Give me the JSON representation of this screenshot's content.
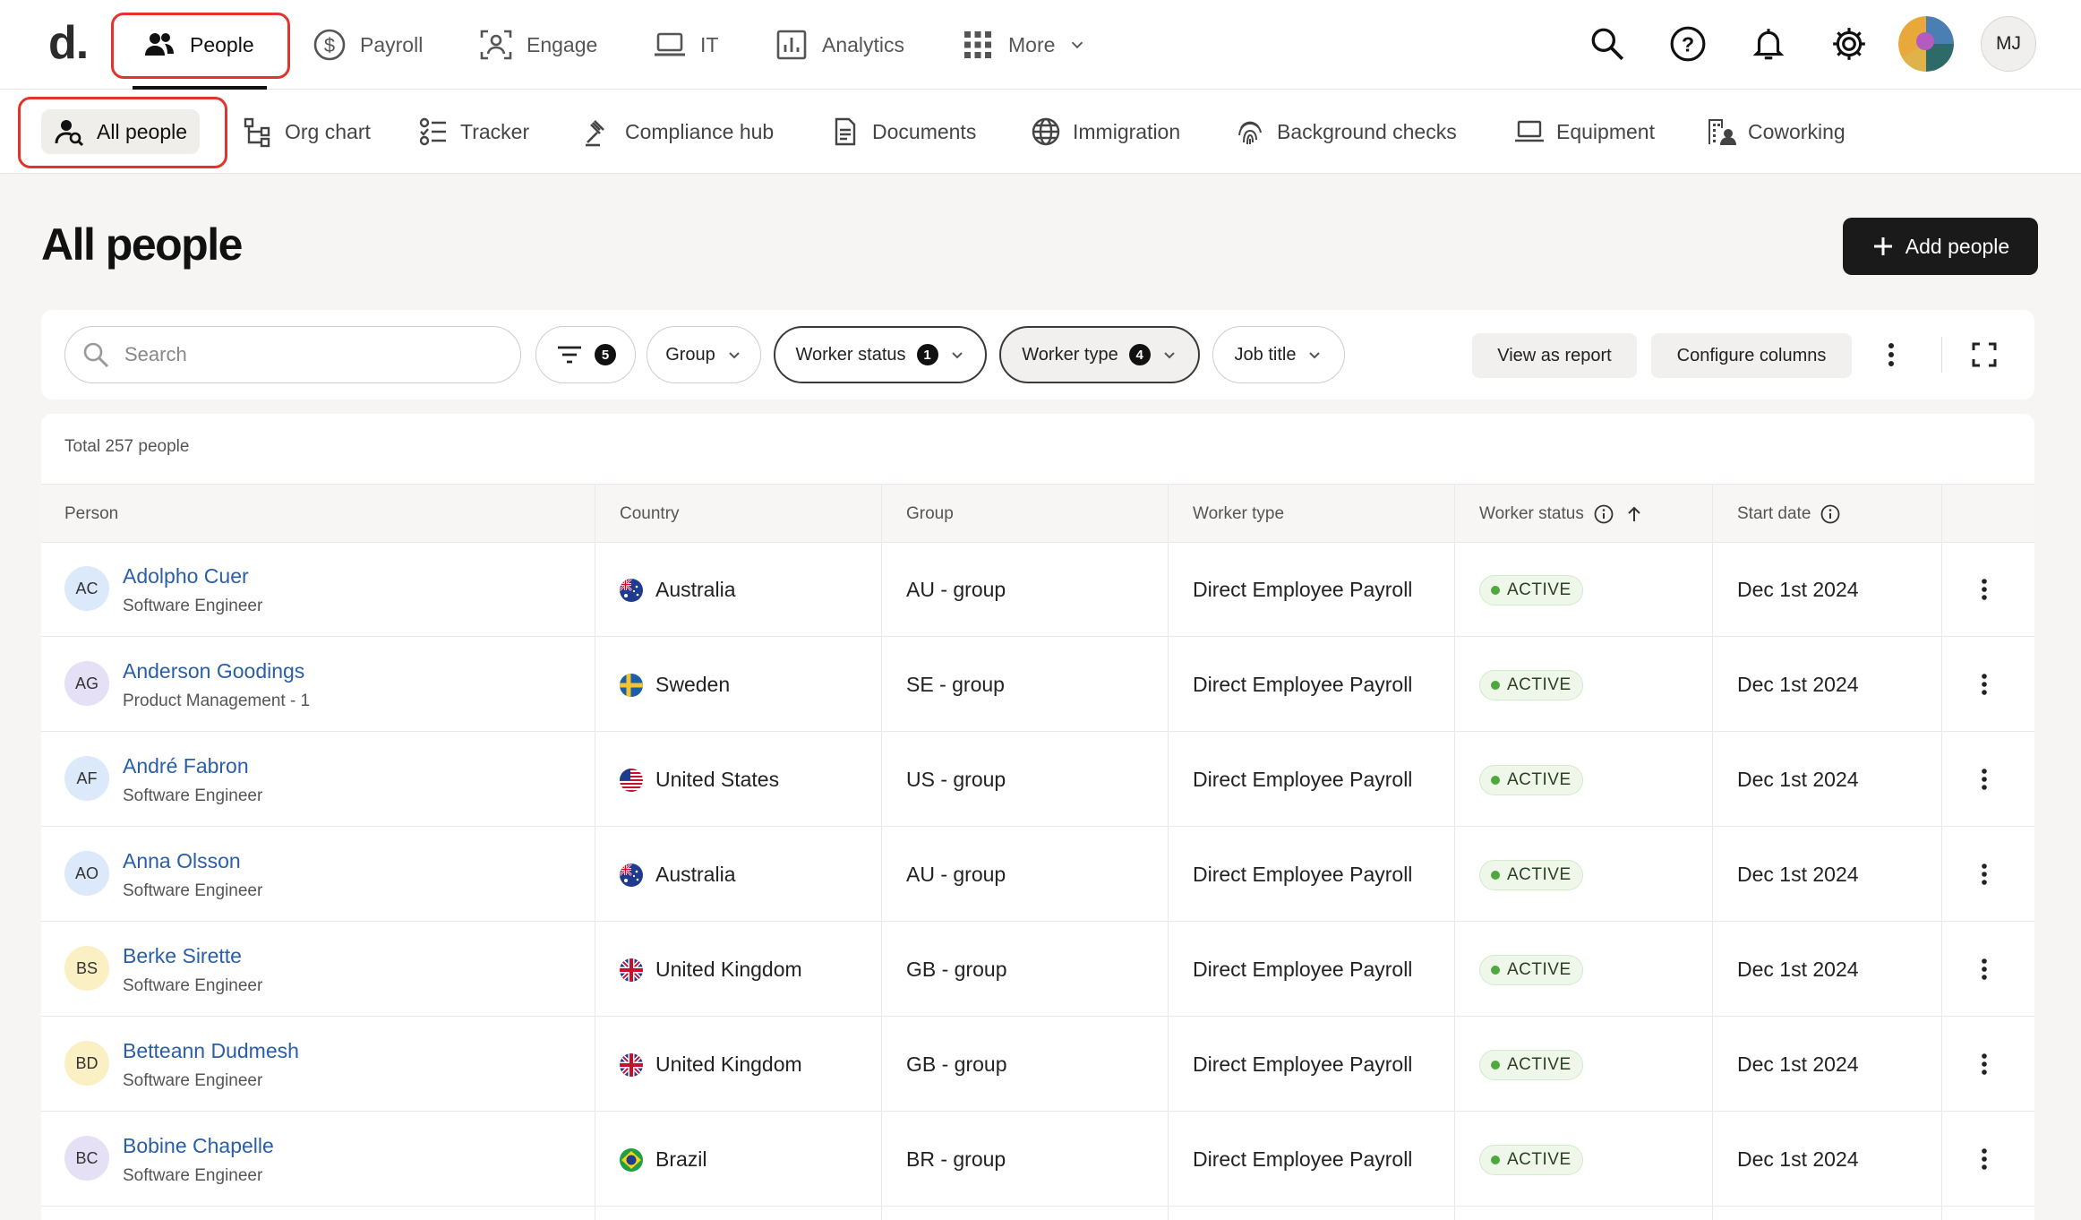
{
  "logo": "d.",
  "topnav": {
    "tabs": [
      {
        "label": "People",
        "icon": "people-icon"
      },
      {
        "label": "Payroll",
        "icon": "dollar-circle-icon"
      },
      {
        "label": "Engage",
        "icon": "engage-icon"
      },
      {
        "label": "IT",
        "icon": "laptop-icon"
      },
      {
        "label": "Analytics",
        "icon": "analytics-icon"
      },
      {
        "label": "More",
        "icon": "grid-icon"
      }
    ],
    "user_initials": "MJ"
  },
  "subnav": {
    "tabs": [
      {
        "label": "All people"
      },
      {
        "label": "Org chart"
      },
      {
        "label": "Tracker"
      },
      {
        "label": "Compliance hub"
      },
      {
        "label": "Documents"
      },
      {
        "label": "Immigration"
      },
      {
        "label": "Background checks"
      },
      {
        "label": "Equipment"
      },
      {
        "label": "Coworking"
      }
    ]
  },
  "page": {
    "title": "All people",
    "add_button": "Add people"
  },
  "filters": {
    "search_placeholder": "Search",
    "filter_count": "5",
    "group": "Group",
    "worker_status": "Worker status",
    "worker_status_count": "1",
    "worker_type": "Worker type",
    "worker_type_count": "4",
    "job_title": "Job title",
    "view_as_report": "View as report",
    "configure_columns": "Configure columns"
  },
  "table": {
    "total": "Total 257 people",
    "headers": {
      "person": "Person",
      "country": "Country",
      "group": "Group",
      "worker_type": "Worker type",
      "worker_status": "Worker status",
      "start_date": "Start date"
    },
    "rows": [
      {
        "initials": "AC",
        "avatar_color": "#dbe9fb",
        "name": "Adolpho Cuer",
        "title": "Software Engineer",
        "country": "Australia",
        "flag": "au",
        "group": "AU - group",
        "worker_type": "Direct Employee Payroll",
        "status": "ACTIVE",
        "start_date": "Dec 1st 2024"
      },
      {
        "initials": "AG",
        "avatar_color": "#e6e0f7",
        "name": "Anderson Goodings",
        "title": "Product Management - 1",
        "country": "Sweden",
        "flag": "se",
        "group": "SE - group",
        "worker_type": "Direct Employee Payroll",
        "status": "ACTIVE",
        "start_date": "Dec 1st 2024"
      },
      {
        "initials": "AF",
        "avatar_color": "#dbe9fb",
        "name": "André Fabron",
        "title": "Software Engineer",
        "country": "United States",
        "flag": "us",
        "group": "US - group",
        "worker_type": "Direct Employee Payroll",
        "status": "ACTIVE",
        "start_date": "Dec 1st 2024"
      },
      {
        "initials": "AO",
        "avatar_color": "#dbe9fb",
        "name": "Anna Olsson",
        "title": "Software Engineer",
        "country": "Australia",
        "flag": "au",
        "group": "AU - group",
        "worker_type": "Direct Employee Payroll",
        "status": "ACTIVE",
        "start_date": "Dec 1st 2024"
      },
      {
        "initials": "BS",
        "avatar_color": "#fbefc4",
        "name": "Berke Sirette",
        "title": "Software Engineer",
        "country": "United Kingdom",
        "flag": "gb",
        "group": "GB - group",
        "worker_type": "Direct Employee Payroll",
        "status": "ACTIVE",
        "start_date": "Dec 1st 2024"
      },
      {
        "initials": "BD",
        "avatar_color": "#fbefc4",
        "name": "Betteann Dudmesh",
        "title": "Software Engineer",
        "country": "United Kingdom",
        "flag": "gb",
        "group": "GB - group",
        "worker_type": "Direct Employee Payroll",
        "status": "ACTIVE",
        "start_date": "Dec 1st 2024"
      },
      {
        "initials": "BC",
        "avatar_color": "#e6e0f7",
        "name": "Bobine Chapelle",
        "title": "Software Engineer",
        "country": "Brazil",
        "flag": "br",
        "group": "BR - group",
        "worker_type": "Direct Employee Payroll",
        "status": "ACTIVE",
        "start_date": "Dec 1st 2024"
      }
    ]
  }
}
